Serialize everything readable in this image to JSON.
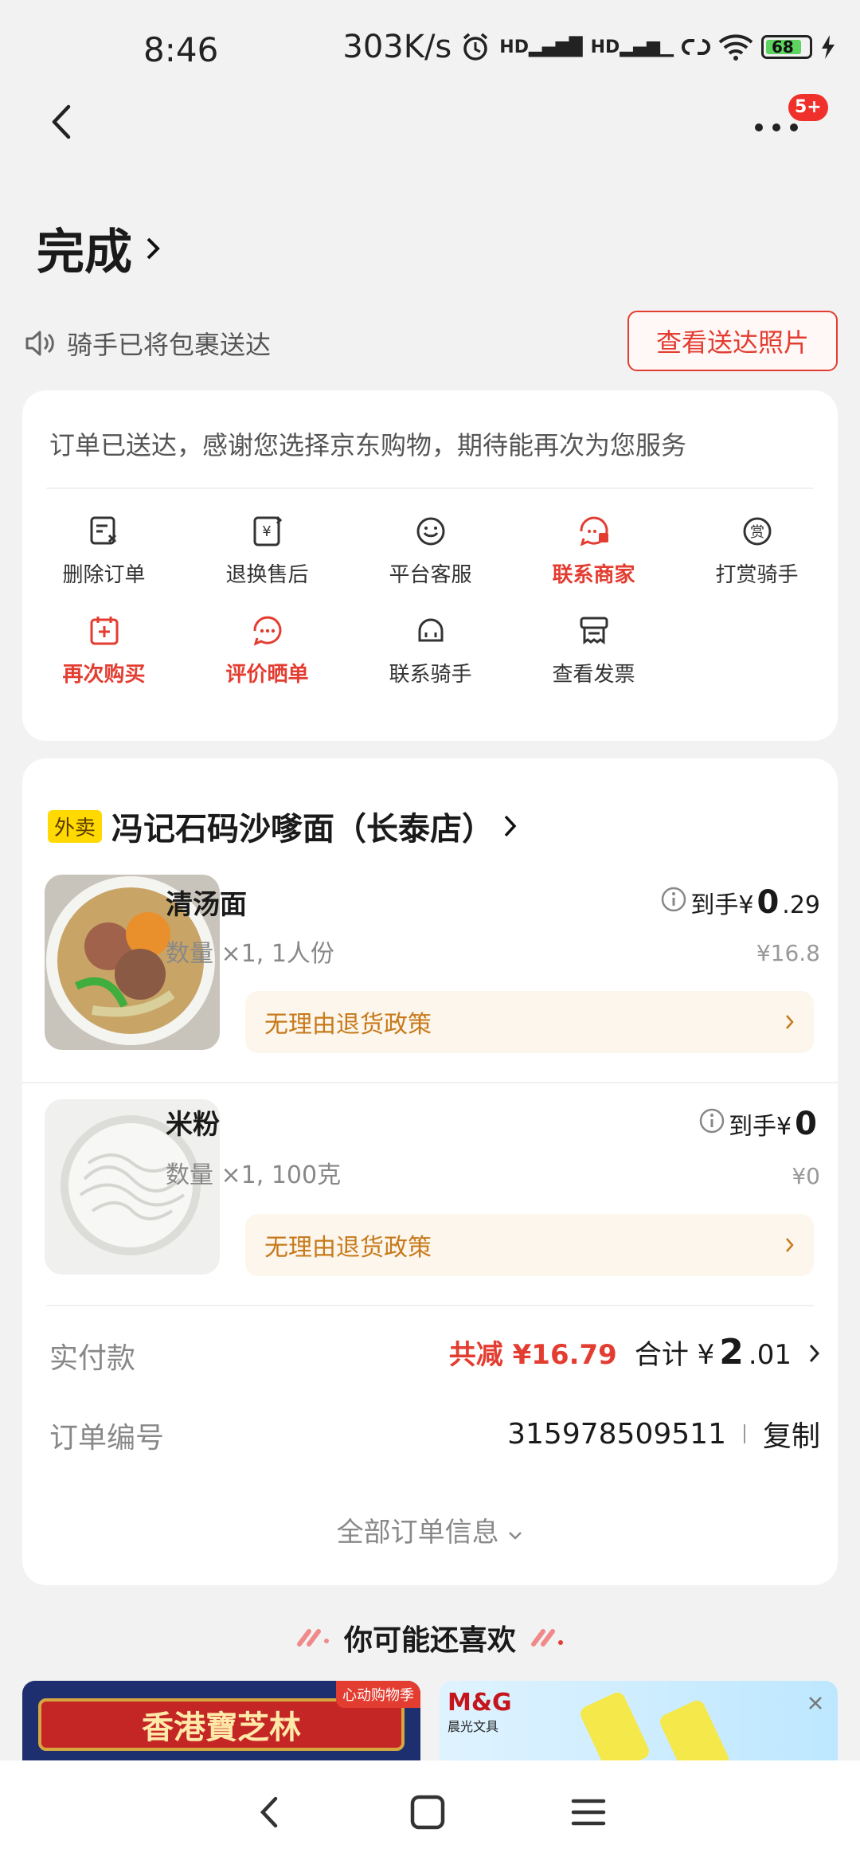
{
  "status": {
    "time": "8:46",
    "speed": "303K/s",
    "battery": "68"
  },
  "nav": {
    "badge": "5+"
  },
  "header": {
    "title": "完成"
  },
  "notice": {
    "text": "骑手已将包裹送达",
    "photo_button": "查看送达照片"
  },
  "card": {
    "thanks": "订单已送达，感谢您选择京东购物，期待能再次为您服务",
    "actions": [
      {
        "label": "删除订单",
        "icon": "delete-order-icon"
      },
      {
        "label": "退换售后",
        "icon": "return-icon"
      },
      {
        "label": "平台客服",
        "icon": "customer-service-icon"
      },
      {
        "label": "联系商家",
        "icon": "merchant-icon"
      },
      {
        "label": "打赏骑手",
        "icon": "tip-icon"
      },
      {
        "label": "再次购买",
        "icon": "rebuy-icon"
      },
      {
        "label": "评价晒单",
        "icon": "review-icon"
      },
      {
        "label": "联系骑手",
        "icon": "rider-icon"
      },
      {
        "label": "查看发票",
        "icon": "invoice-icon"
      }
    ]
  },
  "order": {
    "tag": "外卖",
    "store": "冯记石码沙嗲面（长泰店）",
    "products": [
      {
        "name": "清汤面",
        "qty": "数量 ×1, 1人份",
        "price_prefix": "到手¥",
        "price_int": "0",
        "price_dec": ".29",
        "original": "¥16.8",
        "policy": "无理由退货政策"
      },
      {
        "name": "米粉",
        "qty": "数量 ×1, 100克",
        "price_prefix": "到手¥",
        "price_int": "0",
        "price_dec": "",
        "original": "¥0",
        "policy": "无理由退货政策"
      }
    ],
    "paid_label": "实付款",
    "discount": "共减 ¥16.79",
    "total_prefix": "合计 ¥",
    "total_int": "2",
    "total_dec": ".01",
    "order_no_label": "订单编号",
    "order_no": "315978509511",
    "copy": "复制",
    "all_info": "全部订单信息"
  },
  "recommend": {
    "title": "你可能还喜欢",
    "ad1_text": "香港寶芝林",
    "ad1_tag": "心动购物季",
    "ad2_brand": "M&G",
    "ad2_sub": "晨光文具"
  },
  "colors": {
    "accent": "#e33d31",
    "policy": "#c77a1b"
  }
}
